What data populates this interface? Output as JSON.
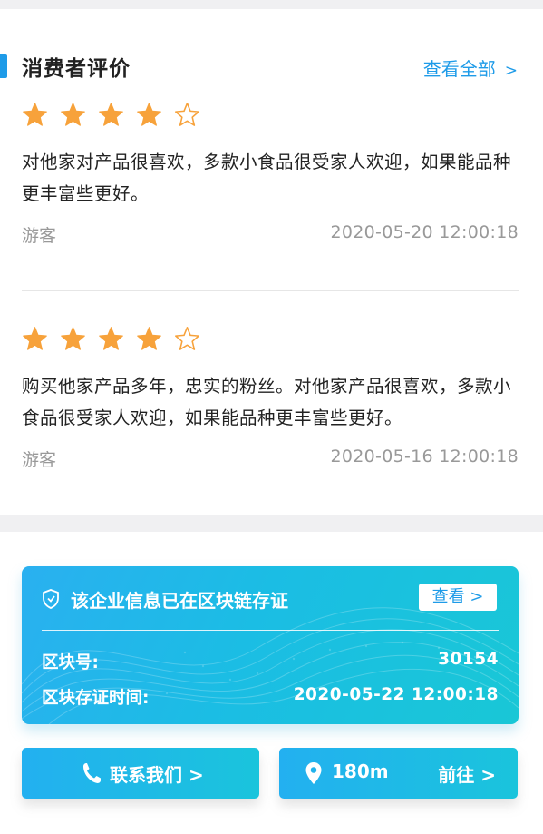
{
  "reviews_section": {
    "title": "消费者评价",
    "view_all_label": "查看全部",
    "view_all_chevron": ">",
    "star_color": "#f7a23b",
    "reviews": [
      {
        "rating": 4,
        "max_rating": 5,
        "text": "对他家对产品很喜欢，多款小食品很受家人欢迎，如果能品种更丰富些更好。",
        "user": "游客",
        "time": "2020-05-20  12:00:18"
      },
      {
        "rating": 4,
        "max_rating": 5,
        "text": "购买他家产品多年，忠实的粉丝。对他家产品很喜欢，多款小食品很受家人欢迎，如果能品种更丰富些更好。",
        "user": "游客",
        "time": "2020-05-16  12:00:18"
      }
    ]
  },
  "blockchain": {
    "title": "该企业信息已在区块链存证",
    "view_button": "查看 >",
    "block_number_label": "区块号:",
    "block_number": "30154",
    "time_label": "区块存证时间:",
    "time": "2020-05-22  12:00:18"
  },
  "actions": {
    "contact_label": "联系我们 >",
    "distance": "180m",
    "goto_label": "前往 >"
  },
  "colors": {
    "accent": "#1e9be8",
    "gradient_start": "#23b0f0",
    "gradient_end": "#1ac4dc"
  }
}
